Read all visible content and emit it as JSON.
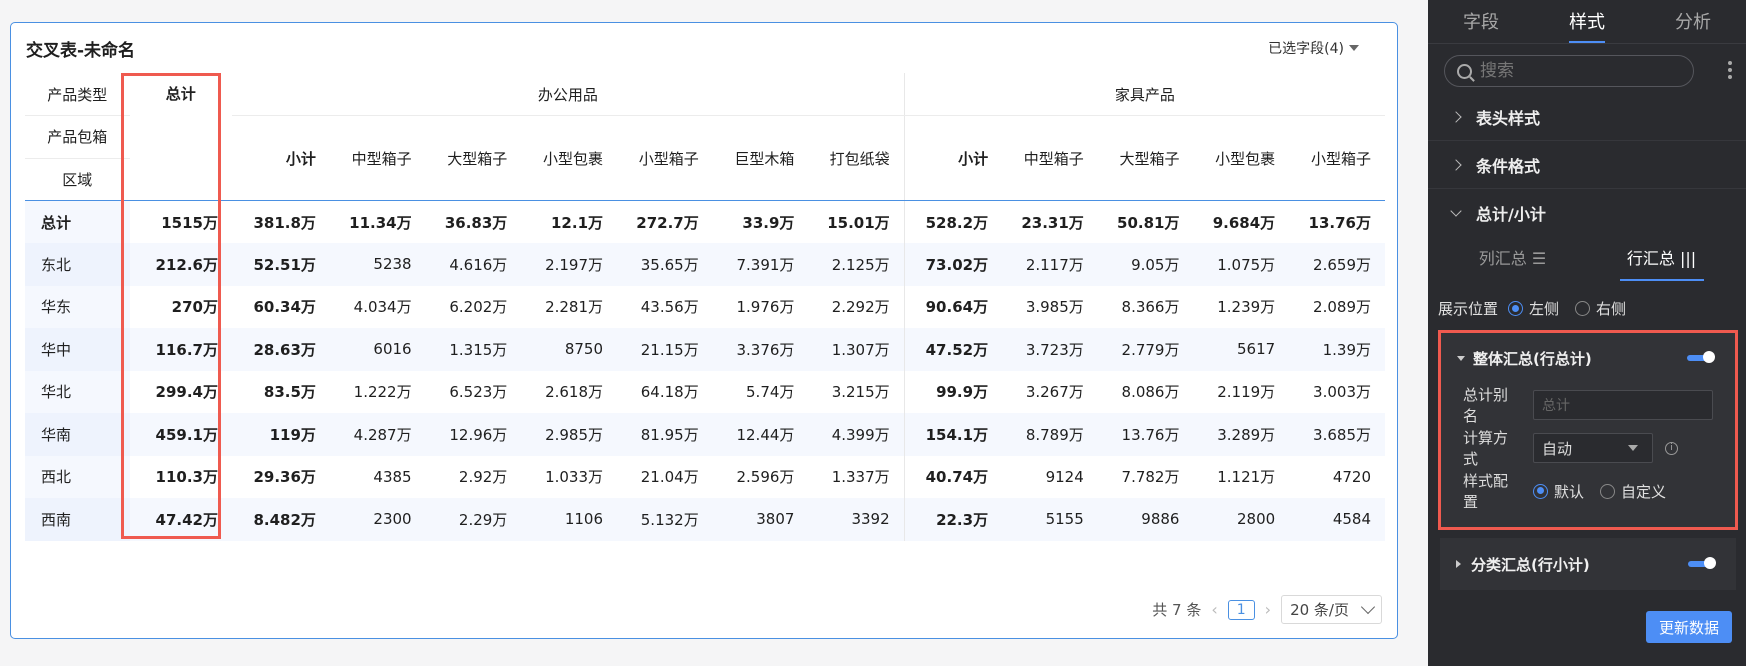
{
  "card": {
    "title": "交叉表-未命名",
    "field_select": "已选字段(4)"
  },
  "table": {
    "row_labels": [
      "产品类型",
      "产品包箱",
      "区域"
    ],
    "total_header": "总计",
    "groups": [
      {
        "name": "办公用品",
        "columns": [
          "小计",
          "中型箱子",
          "大型箱子",
          "小型包裹",
          "小型箱子",
          "巨型木箱",
          "打包纸袋"
        ]
      },
      {
        "name": "家具产品",
        "columns": [
          "小计",
          "中型箱子",
          "大型箱子",
          "小型包裹",
          "小型箱子"
        ]
      }
    ],
    "rows": [
      {
        "region": "总计",
        "total": "1515万",
        "values": [
          "381.8万",
          "11.34万",
          "36.83万",
          "12.1万",
          "272.7万",
          "33.9万",
          "15.01万",
          "528.2万",
          "23.31万",
          "50.81万",
          "9.684万",
          "13.76万"
        ]
      },
      {
        "region": "东北",
        "total": "212.6万",
        "values": [
          "52.51万",
          "5238",
          "4.616万",
          "2.197万",
          "35.65万",
          "7.391万",
          "2.125万",
          "73.02万",
          "2.117万",
          "9.05万",
          "1.075万",
          "2.659万"
        ]
      },
      {
        "region": "华东",
        "total": "270万",
        "values": [
          "60.34万",
          "4.034万",
          "6.202万",
          "2.281万",
          "43.56万",
          "1.976万",
          "2.292万",
          "90.64万",
          "3.985万",
          "8.366万",
          "1.239万",
          "2.089万"
        ]
      },
      {
        "region": "华中",
        "total": "116.7万",
        "values": [
          "28.63万",
          "6016",
          "1.315万",
          "8750",
          "21.15万",
          "3.376万",
          "1.307万",
          "47.52万",
          "3.723万",
          "2.779万",
          "5617",
          "1.39万"
        ]
      },
      {
        "region": "华北",
        "total": "299.4万",
        "values": [
          "83.5万",
          "1.222万",
          "6.523万",
          "2.618万",
          "64.18万",
          "5.74万",
          "3.215万",
          "99.9万",
          "3.267万",
          "8.086万",
          "2.119万",
          "3.003万"
        ]
      },
      {
        "region": "华南",
        "total": "459.1万",
        "values": [
          "119万",
          "4.287万",
          "12.96万",
          "2.985万",
          "81.95万",
          "12.44万",
          "4.399万",
          "154.1万",
          "8.789万",
          "13.76万",
          "3.289万",
          "3.685万"
        ]
      },
      {
        "region": "西北",
        "total": "110.3万",
        "values": [
          "29.36万",
          "4385",
          "2.92万",
          "1.033万",
          "21.04万",
          "2.596万",
          "1.337万",
          "40.74万",
          "9124",
          "7.782万",
          "1.121万",
          "4720"
        ]
      },
      {
        "region": "西南",
        "total": "47.42万",
        "values": [
          "8.482万",
          "2300",
          "2.29万",
          "1106",
          "5.132万",
          "3807",
          "3392",
          "22.3万",
          "5155",
          "9886",
          "2800",
          "4584"
        ]
      }
    ]
  },
  "pager": {
    "total_text": "共 7 条",
    "current_page": "1",
    "page_size": "20 条/页"
  },
  "panel": {
    "tabs": [
      "字段",
      "样式",
      "分析"
    ],
    "active_tab": 1,
    "search_placeholder": "搜索",
    "sections": [
      "表头样式",
      "条件格式",
      "总计/小计"
    ],
    "subtabs": [
      "列汇总 ☰",
      "行汇总 |||"
    ],
    "position_label": "展示位置",
    "position_options": [
      "左侧",
      "右侧"
    ],
    "grand_total": {
      "title": "整体汇总(行总计)",
      "alias_label": "总计别名",
      "alias_placeholder": "总计",
      "calc_label": "计算方式",
      "calc_value": "自动",
      "style_label": "样式配置",
      "style_options": [
        "默认",
        "自定义"
      ]
    },
    "category_total_title": "分类汇总(行小计)",
    "update_button": "更新数据"
  },
  "colors": {
    "accent": "#4d8ef5",
    "highlight": "#ef5a4f",
    "panel_bg": "#2a2b2f"
  }
}
